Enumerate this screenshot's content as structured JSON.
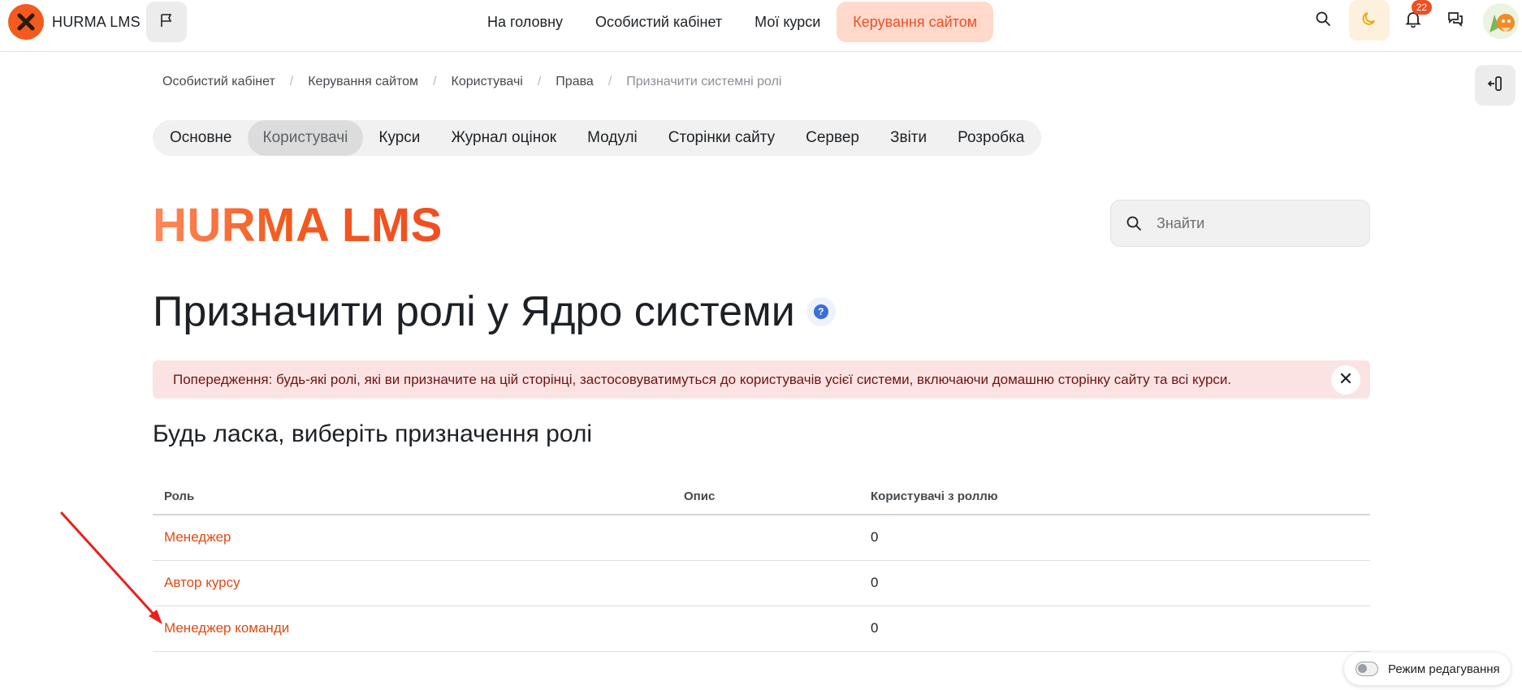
{
  "brand": {
    "name": "HURMA LMS"
  },
  "primary_nav": [
    {
      "label": "На головну",
      "active": false
    },
    {
      "label": "Особистий кабінет",
      "active": false
    },
    {
      "label": "Мої курси",
      "active": false
    },
    {
      "label": "Керування сайтом",
      "active": true
    }
  ],
  "notifications": {
    "count": "22"
  },
  "breadcrumb": [
    "Особистий кабінет",
    "Керування сайтом",
    "Користувачі",
    "Права",
    "Призначити системні ролі"
  ],
  "secondary_nav": [
    {
      "label": "Основне",
      "active": false
    },
    {
      "label": "Користувачі",
      "active": true
    },
    {
      "label": "Курси",
      "active": false
    },
    {
      "label": "Журнал оцінок",
      "active": false
    },
    {
      "label": "Модулі",
      "active": false
    },
    {
      "label": "Сторінки сайту",
      "active": false
    },
    {
      "label": "Сервер",
      "active": false
    },
    {
      "label": "Звіти",
      "active": false
    },
    {
      "label": "Розробка",
      "active": false
    }
  ],
  "site_logo": "HURMA LMS",
  "search": {
    "placeholder": "Знайти"
  },
  "page_title": "Призначити ролі у Ядро системи",
  "alert": {
    "text": "Попередження: будь-які ролі, які ви призначите на цій сторінці, застосовуватимуться до користувачів усієї системи, включаючи домашню сторінку сайту та всі курси."
  },
  "section_heading": "Будь ласка, виберіть призначення ролі",
  "table": {
    "headers": [
      "Роль",
      "Опис",
      "Користувачі з роллю"
    ],
    "rows": [
      {
        "role": "Менеджер",
        "description": "",
        "users": "0"
      },
      {
        "role": "Автор курсу",
        "description": "",
        "users": "0"
      },
      {
        "role": "Менеджер команди",
        "description": "",
        "users": "0"
      }
    ]
  },
  "edit_mode": {
    "label": "Режим редагування",
    "enabled": false
  },
  "colors": {
    "accent": "#f04e23",
    "link": "#e04a10",
    "alert_bg": "#fbe3e3",
    "annotation_arrow": "#e8201a"
  },
  "icons": [
    "flag-icon",
    "search-icon",
    "moon-icon",
    "bell-icon",
    "chat-icon",
    "close-icon",
    "help-icon",
    "drawer-open-icon"
  ]
}
